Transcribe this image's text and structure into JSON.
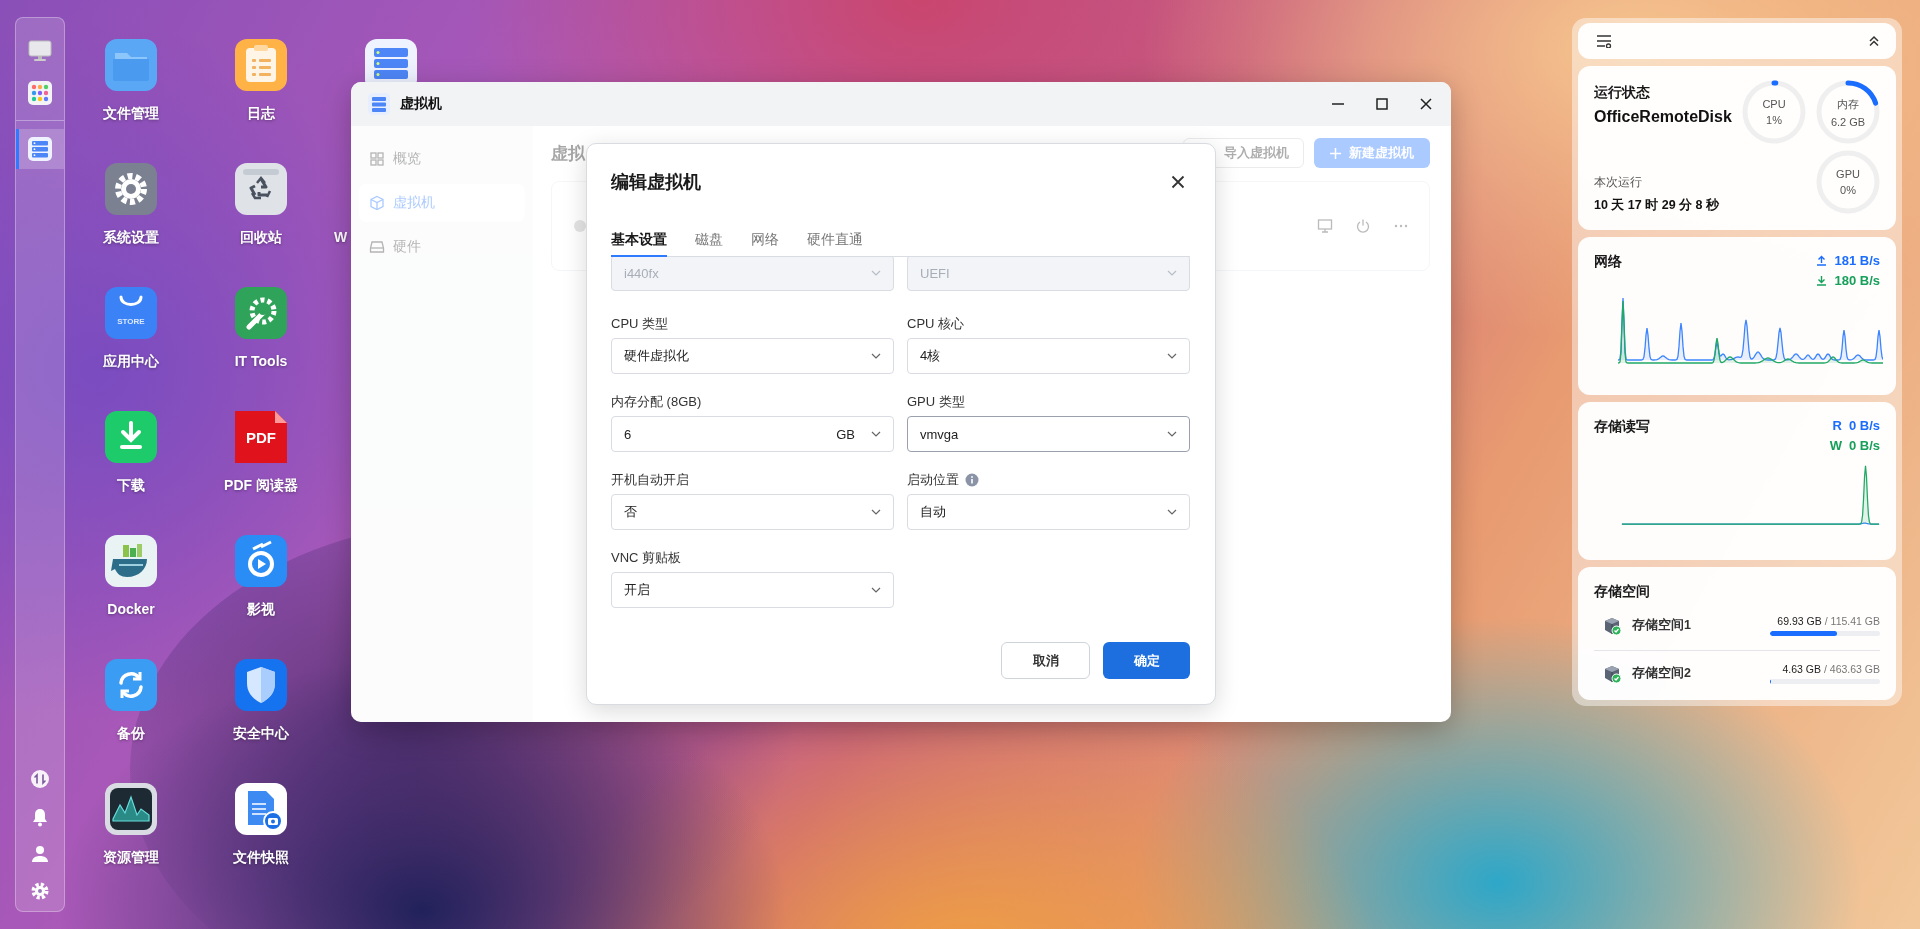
{
  "dock": {
    "items": [
      {
        "kind": "desktop",
        "selected": false
      },
      {
        "kind": "apps",
        "selected": false
      },
      {
        "kind": "vm",
        "selected": true
      }
    ],
    "bottom_items": [
      {
        "kind": "transfer"
      },
      {
        "kind": "notifications"
      },
      {
        "kind": "account"
      },
      {
        "kind": "settings"
      }
    ]
  },
  "desktop": {
    "columns": [
      [
        {
          "kind": "files",
          "label": "文件管理"
        },
        {
          "kind": "settings",
          "label": "系统设置"
        },
        {
          "kind": "store",
          "label": "应用中心",
          "icon_text": "STORE"
        },
        {
          "kind": "download",
          "label": "下载"
        },
        {
          "kind": "docker",
          "label": "Docker"
        },
        {
          "kind": "backup",
          "label": "备份"
        },
        {
          "kind": "monitor",
          "label": "资源管理"
        }
      ],
      [
        {
          "kind": "log",
          "label": "日志"
        },
        {
          "kind": "recycle",
          "label": "回收站"
        },
        {
          "kind": "ittools",
          "label": "IT Tools"
        },
        {
          "kind": "pdf",
          "label": "PDF 阅读器",
          "icon_text": "PDF"
        },
        {
          "kind": "video",
          "label": "影视"
        },
        {
          "kind": "security",
          "label": "安全中心"
        },
        {
          "kind": "snapshot",
          "label": "文件快照"
        }
      ],
      [
        {
          "kind": "server"
        },
        {
          "label": "W"
        }
      ]
    ]
  },
  "window": {
    "title": "虚拟机",
    "sidebar": [
      {
        "kind": "overview",
        "label": "概览",
        "selected": false
      },
      {
        "kind": "vm",
        "label": "虚拟机",
        "selected": true
      },
      {
        "kind": "hardware",
        "label": "硬件",
        "selected": false
      }
    ],
    "heading": "虚拟",
    "import_button": "导入虚拟机",
    "new_button": "新建虚拟机"
  },
  "dialog": {
    "title": "编辑虚拟机",
    "tabs": [
      {
        "label": "基本设置",
        "selected": true
      },
      {
        "label": "磁盘",
        "selected": false
      },
      {
        "label": "网络",
        "selected": false
      },
      {
        "label": "硬件直通",
        "selected": false
      }
    ],
    "fields": [
      {
        "value": "i440fx",
        "disabled": true,
        "focused": false
      },
      {
        "value": "UEFI",
        "disabled": true,
        "focused": false
      },
      {
        "label": "CPU 类型",
        "value": "硬件虚拟化",
        "disabled": false,
        "focused": false
      },
      {
        "label": "CPU 核心",
        "value": "4核",
        "disabled": false,
        "focused": false
      },
      {
        "label": "内存分配 (8GB)",
        "value": "6",
        "unit": "GB",
        "disabled": false,
        "focused": false
      },
      {
        "label": "GPU 类型",
        "value": "vmvga",
        "disabled": false,
        "focused": true
      },
      {
        "label": "开机自动开启",
        "value": "否",
        "disabled": false,
        "focused": false
      },
      {
        "label": "启动位置",
        "value": "自动",
        "disabled": false,
        "focused": false,
        "info": true
      },
      {
        "label": "VNC 剪贴板",
        "value": "开启",
        "disabled": false,
        "focused": false
      }
    ],
    "cancel": "取消",
    "confirm": "确定"
  },
  "widgets": {
    "status": {
      "title": "运行状态",
      "host": "OfficeRemoteDisk",
      "uptime_label": "本次运行",
      "uptime": "10 天 17 时 29 分 8 秒",
      "meters": [
        {
          "label": "CPU",
          "reading": "1%",
          "level": 0.01
        },
        {
          "label": "内存",
          "reading": "6.2 GB",
          "level": 0.2
        },
        {
          "label": "GPU",
          "reading": "0%",
          "level": 0
        }
      ]
    },
    "network": {
      "title": "网络",
      "upload": "181 B/s",
      "download": "180 B/s"
    },
    "storage_io": {
      "title": "存储读写",
      "read_label": "R",
      "read": "0 B/s",
      "write_label": "W",
      "write": "0 B/s"
    },
    "storage": {
      "title": "存储空间",
      "volumes": [
        {
          "name": "存储空间1",
          "used": "69.93 GB",
          "total": "/ 115.41 GB",
          "level": 0.606
        },
        {
          "name": "存储空间2",
          "used": "4.63 GB",
          "total": "/ 463.63 GB",
          "level": 0.01
        }
      ]
    }
  }
}
